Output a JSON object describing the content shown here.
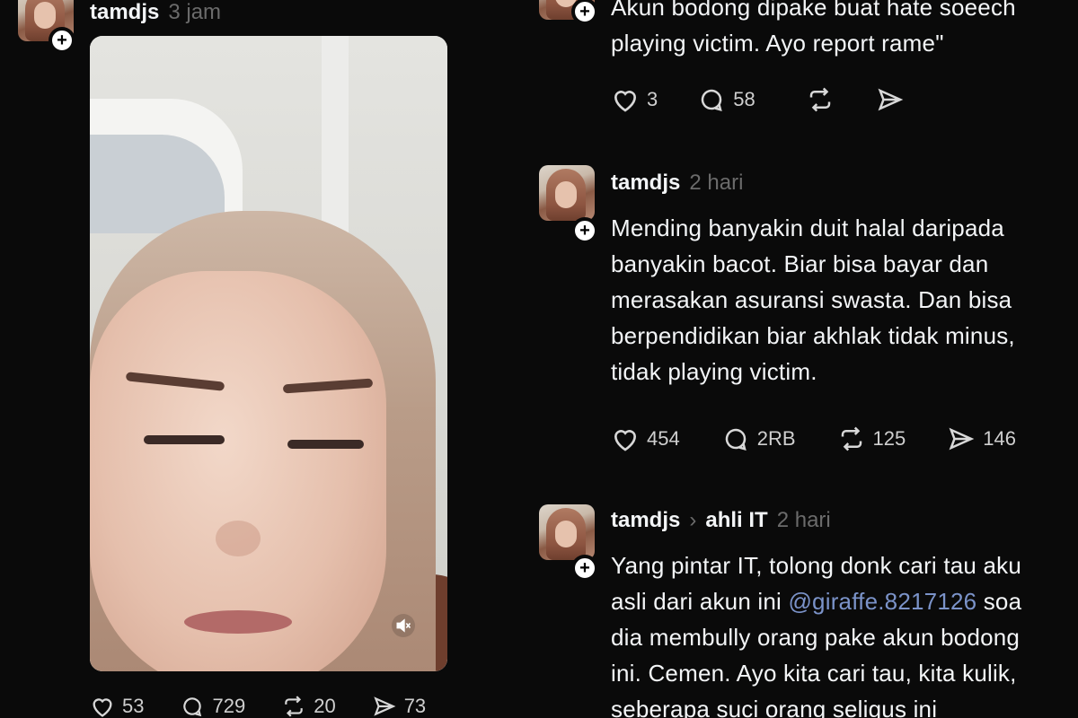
{
  "left_post": {
    "username": "tamdjs",
    "time": "3 jam",
    "stats": {
      "likes": "53",
      "replies": "729",
      "reposts": "20",
      "shares": "73"
    }
  },
  "post_top": {
    "text": "Akun bodong dipake buat hate soeech\nplaying victim. Ayo report rame\"",
    "stats": {
      "likes": "3",
      "replies": "58"
    }
  },
  "post_middle": {
    "username": "tamdjs",
    "time": "2 hari",
    "text": "Mending banyakin duit halal daripada\nbanyakin bacot. Biar bisa bayar dan\nmerasakan asuransi swasta. Dan bisa\nberpendidikan biar akhlak tidak minus,\ntidak playing victim.",
    "stats": {
      "likes": "454",
      "replies": "2RB",
      "reposts": "125",
      "shares": "146"
    }
  },
  "post_bottom": {
    "username": "tamdjs",
    "reply_to": "ahli IT",
    "time": "2 hari",
    "line1": "Yang pintar IT, tolong donk cari tau aku",
    "line2_pre": "asli dari akun ini ",
    "mention": "@giraffe.8217126",
    "line2_post": " soa",
    "line3": "dia membully orang pake akun bodong",
    "line4": "ini. Cemen. Ayo kita cari tau, kita kulik,",
    "line5": "seberapa suci orang seligus ini"
  },
  "icons": {
    "like": "heart-icon",
    "reply": "comment-icon",
    "repost": "repost-icon",
    "share": "send-icon",
    "follow": "plus-icon",
    "mute": "speaker-muted-icon"
  },
  "colors": {
    "background": "#0a0a0a",
    "text": "#f3f5f7",
    "muted": "#6b6b6b",
    "mention": "#7b93c9"
  }
}
